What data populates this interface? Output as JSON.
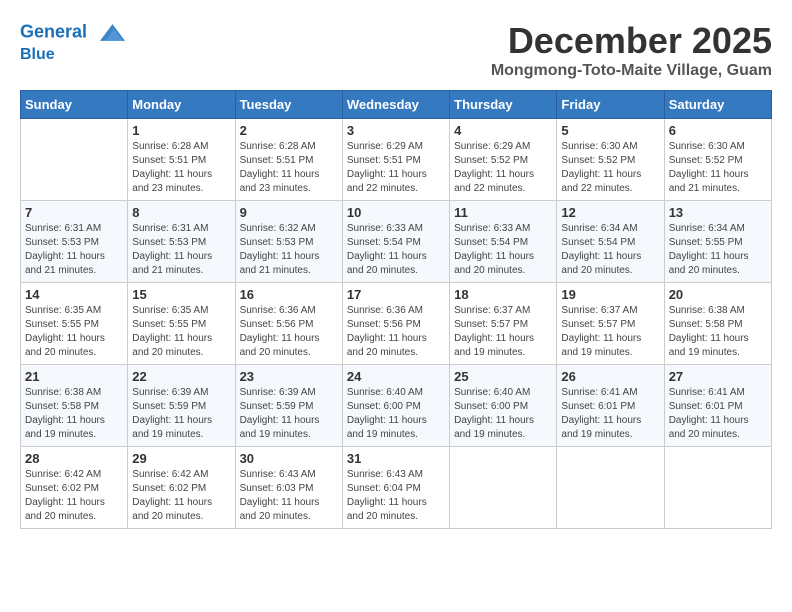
{
  "header": {
    "logo_line1": "General",
    "logo_line2": "Blue",
    "month_year": "December 2025",
    "location": "Mongmong-Toto-Maite Village, Guam"
  },
  "days_of_week": [
    "Sunday",
    "Monday",
    "Tuesday",
    "Wednesday",
    "Thursday",
    "Friday",
    "Saturday"
  ],
  "weeks": [
    [
      {
        "day": "",
        "sunrise": "",
        "sunset": "",
        "daylight": ""
      },
      {
        "day": "1",
        "sunrise": "6:28 AM",
        "sunset": "5:51 PM",
        "daylight": "11 hours and 23 minutes."
      },
      {
        "day": "2",
        "sunrise": "6:28 AM",
        "sunset": "5:51 PM",
        "daylight": "11 hours and 23 minutes."
      },
      {
        "day": "3",
        "sunrise": "6:29 AM",
        "sunset": "5:51 PM",
        "daylight": "11 hours and 22 minutes."
      },
      {
        "day": "4",
        "sunrise": "6:29 AM",
        "sunset": "5:52 PM",
        "daylight": "11 hours and 22 minutes."
      },
      {
        "day": "5",
        "sunrise": "6:30 AM",
        "sunset": "5:52 PM",
        "daylight": "11 hours and 22 minutes."
      },
      {
        "day": "6",
        "sunrise": "6:30 AM",
        "sunset": "5:52 PM",
        "daylight": "11 hours and 21 minutes."
      }
    ],
    [
      {
        "day": "7",
        "sunrise": "6:31 AM",
        "sunset": "5:53 PM",
        "daylight": "11 hours and 21 minutes."
      },
      {
        "day": "8",
        "sunrise": "6:31 AM",
        "sunset": "5:53 PM",
        "daylight": "11 hours and 21 minutes."
      },
      {
        "day": "9",
        "sunrise": "6:32 AM",
        "sunset": "5:53 PM",
        "daylight": "11 hours and 21 minutes."
      },
      {
        "day": "10",
        "sunrise": "6:33 AM",
        "sunset": "5:54 PM",
        "daylight": "11 hours and 20 minutes."
      },
      {
        "day": "11",
        "sunrise": "6:33 AM",
        "sunset": "5:54 PM",
        "daylight": "11 hours and 20 minutes."
      },
      {
        "day": "12",
        "sunrise": "6:34 AM",
        "sunset": "5:54 PM",
        "daylight": "11 hours and 20 minutes."
      },
      {
        "day": "13",
        "sunrise": "6:34 AM",
        "sunset": "5:55 PM",
        "daylight": "11 hours and 20 minutes."
      }
    ],
    [
      {
        "day": "14",
        "sunrise": "6:35 AM",
        "sunset": "5:55 PM",
        "daylight": "11 hours and 20 minutes."
      },
      {
        "day": "15",
        "sunrise": "6:35 AM",
        "sunset": "5:55 PM",
        "daylight": "11 hours and 20 minutes."
      },
      {
        "day": "16",
        "sunrise": "6:36 AM",
        "sunset": "5:56 PM",
        "daylight": "11 hours and 20 minutes."
      },
      {
        "day": "17",
        "sunrise": "6:36 AM",
        "sunset": "5:56 PM",
        "daylight": "11 hours and 20 minutes."
      },
      {
        "day": "18",
        "sunrise": "6:37 AM",
        "sunset": "5:57 PM",
        "daylight": "11 hours and 19 minutes."
      },
      {
        "day": "19",
        "sunrise": "6:37 AM",
        "sunset": "5:57 PM",
        "daylight": "11 hours and 19 minutes."
      },
      {
        "day": "20",
        "sunrise": "6:38 AM",
        "sunset": "5:58 PM",
        "daylight": "11 hours and 19 minutes."
      }
    ],
    [
      {
        "day": "21",
        "sunrise": "6:38 AM",
        "sunset": "5:58 PM",
        "daylight": "11 hours and 19 minutes."
      },
      {
        "day": "22",
        "sunrise": "6:39 AM",
        "sunset": "5:59 PM",
        "daylight": "11 hours and 19 minutes."
      },
      {
        "day": "23",
        "sunrise": "6:39 AM",
        "sunset": "5:59 PM",
        "daylight": "11 hours and 19 minutes."
      },
      {
        "day": "24",
        "sunrise": "6:40 AM",
        "sunset": "6:00 PM",
        "daylight": "11 hours and 19 minutes."
      },
      {
        "day": "25",
        "sunrise": "6:40 AM",
        "sunset": "6:00 PM",
        "daylight": "11 hours and 19 minutes."
      },
      {
        "day": "26",
        "sunrise": "6:41 AM",
        "sunset": "6:01 PM",
        "daylight": "11 hours and 19 minutes."
      },
      {
        "day": "27",
        "sunrise": "6:41 AM",
        "sunset": "6:01 PM",
        "daylight": "11 hours and 20 minutes."
      }
    ],
    [
      {
        "day": "28",
        "sunrise": "6:42 AM",
        "sunset": "6:02 PM",
        "daylight": "11 hours and 20 minutes."
      },
      {
        "day": "29",
        "sunrise": "6:42 AM",
        "sunset": "6:02 PM",
        "daylight": "11 hours and 20 minutes."
      },
      {
        "day": "30",
        "sunrise": "6:43 AM",
        "sunset": "6:03 PM",
        "daylight": "11 hours and 20 minutes."
      },
      {
        "day": "31",
        "sunrise": "6:43 AM",
        "sunset": "6:04 PM",
        "daylight": "11 hours and 20 minutes."
      },
      {
        "day": "",
        "sunrise": "",
        "sunset": "",
        "daylight": ""
      },
      {
        "day": "",
        "sunrise": "",
        "sunset": "",
        "daylight": ""
      },
      {
        "day": "",
        "sunrise": "",
        "sunset": "",
        "daylight": ""
      }
    ]
  ],
  "labels": {
    "sunrise_prefix": "Sunrise: ",
    "sunset_prefix": "Sunset: ",
    "daylight_prefix": "Daylight: "
  }
}
